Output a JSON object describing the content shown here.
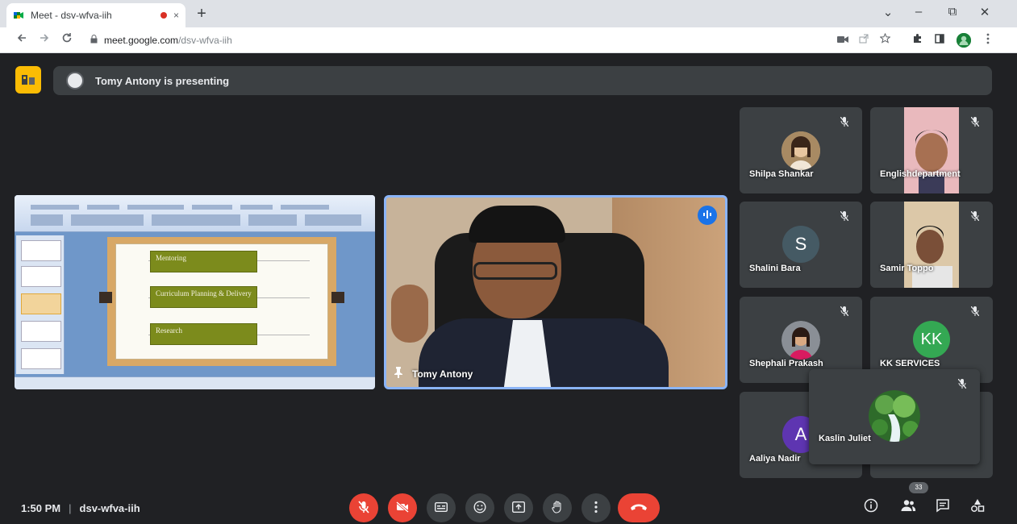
{
  "browser": {
    "tab_title": "Meet - dsv-wfva-iih",
    "tab_close": "×",
    "new_tab": "+",
    "url_host": "meet.google.com",
    "url_path": "/dsv-wfva-iih",
    "win_minimize": "–",
    "win_restore": "⧉",
    "win_close": "✕",
    "win_dropdown": "⌄"
  },
  "meet": {
    "presenting_text": "Tomy Antony is presenting",
    "presenter_name": "Tomy Antony",
    "slide_items": [
      "Mentoring",
      "Curriculum Planning & Delivery",
      "Research"
    ],
    "participants": [
      {
        "name": "Shilpa Shankar",
        "type": "photo"
      },
      {
        "name": "Englishdepartment",
        "type": "video"
      },
      {
        "name": "Shalini Bara",
        "type": "initial",
        "initial": "S",
        "color": "#455a64"
      },
      {
        "name": "Samir Toppo",
        "type": "video"
      },
      {
        "name": "Shephali Prakash",
        "type": "photo"
      },
      {
        "name": "KK SERVICES",
        "type": "initial",
        "initial": "KK",
        "color": "#34a853"
      },
      {
        "name": "Aaliya Nadir",
        "type": "initial",
        "initial": "A",
        "color": "#5e35b1"
      },
      {
        "name": "Kaslin Juliet",
        "type": "photo"
      }
    ],
    "time": "1:50 PM",
    "separator": "|",
    "meeting_code": "dsv-wfva-iih",
    "people_count": "33"
  },
  "colors": {
    "background": "#202124",
    "tile": "#3c4043",
    "danger": "#ea4335",
    "accent": "#8ab4f8"
  },
  "icons": {
    "mic_off": "mic-off-icon",
    "cam_off": "camera-off-icon",
    "captions": "captions-icon",
    "emoji": "emoji-icon",
    "present": "present-icon",
    "raise_hand": "hand-icon",
    "more": "more-vert-icon",
    "hangup": "call-end-icon"
  }
}
